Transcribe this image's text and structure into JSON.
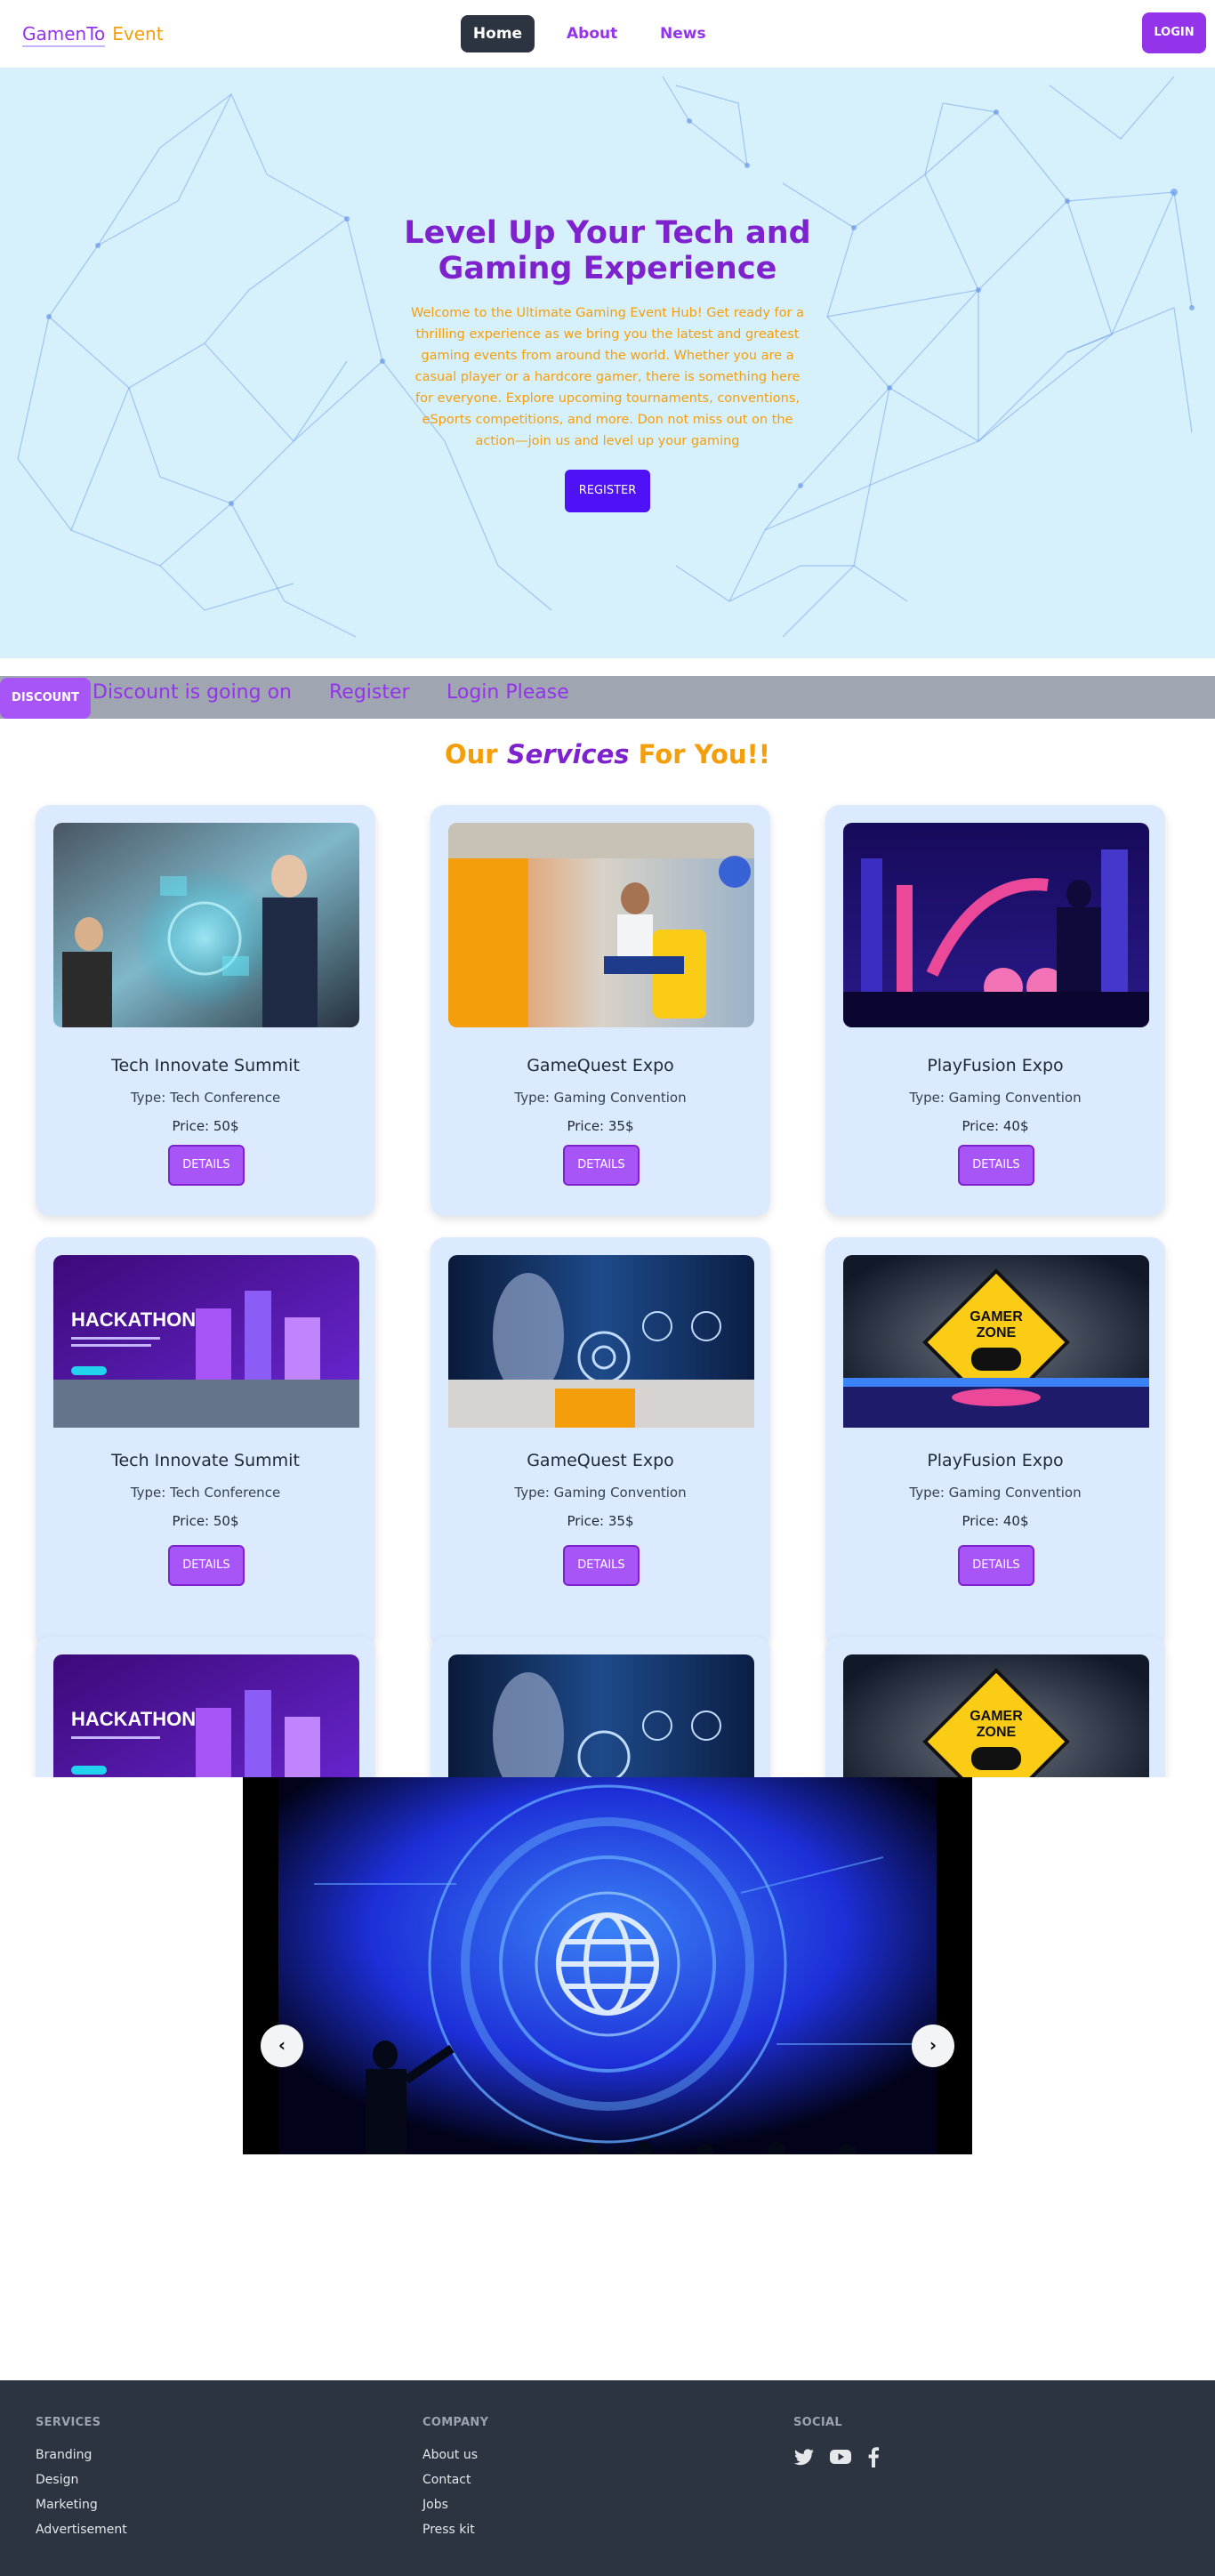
{
  "nav": {
    "logo_part1": "GamenTo",
    "logo_part2": "Event",
    "links": [
      "Home",
      "About",
      "News"
    ],
    "login": "LOGIN"
  },
  "hero": {
    "title": "Level Up Your Tech and Gaming Experience",
    "text": "Welcome to the Ultimate Gaming Event Hub! Get ready for a thrilling experience as we bring you the latest and greatest gaming events from around the world. Whether you are a casual player or a hardcore gamer, there is something here for everyone. Explore upcoming tournaments, conventions, eSports competitions, and more. Don not miss out on the action—join us and level up your gaming",
    "button": "REGISTER"
  },
  "discount": {
    "badge": "DISCOUNT",
    "items": [
      "Discount is going on",
      "Register",
      "Login Please"
    ]
  },
  "services": {
    "title_part1": "Our",
    "title_part2": "Services",
    "title_part3": "For You!!",
    "cards": [
      {
        "name": "Tech Innovate Summit",
        "type": "Type: Tech Conference",
        "price": "Price: 50$",
        "button": "DETAILS"
      },
      {
        "name": "GameQuest Expo",
        "type": "Type: Gaming Convention",
        "price": "Price: 35$",
        "button": "DETAILS"
      },
      {
        "name": "PlayFusion Expo",
        "type": "Type: Gaming Convention",
        "price": "Price: 40$",
        "button": "DETAILS"
      },
      {
        "name": "Tech Innovate Summit",
        "type": "Type: Tech Conference",
        "price": "Price: 50$",
        "button": "DETAILS"
      },
      {
        "name": "GameQuest Expo",
        "type": "Type: Gaming Convention",
        "price": "Price: 35$",
        "button": "DETAILS"
      },
      {
        "name": "PlayFusion Expo",
        "type": "Type: Gaming Convention",
        "price": "Price: 40$",
        "button": "DETAILS"
      }
    ],
    "image_texts": {
      "hackathon": "HACKATHON",
      "gamer_zone_line1": "GAMER",
      "gamer_zone_line2": "ZONE"
    }
  },
  "carousel": {
    "prev": "‹",
    "next": "›"
  },
  "footer": {
    "services_heading": "SERVICES",
    "services_links": [
      "Branding",
      "Design",
      "Marketing",
      "Advertisement"
    ],
    "company_heading": "COMPANY",
    "company_links": [
      "About us",
      "Contact",
      "Jobs",
      "Press kit"
    ],
    "social_heading": "SOCIAL",
    "social_icons": [
      "twitter-icon",
      "youtube-icon",
      "facebook-icon"
    ]
  },
  "colors": {
    "brand_purple": "#9333ea",
    "accent_orange": "#f59e0b",
    "hero_bg": "#d6f0fc",
    "footer_bg": "#2b3440",
    "card_bg": "#dbeafe"
  }
}
